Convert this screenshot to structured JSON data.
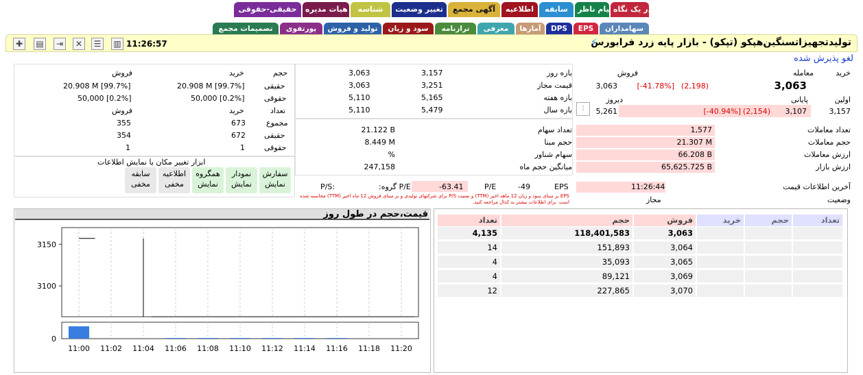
{
  "tabs_row1": [
    {
      "label": "در یک نگاه",
      "bg": "#c1273c",
      "fg": "#fff"
    },
    {
      "label": "پیام ناظر",
      "bg": "#14834a",
      "fg": "#fff"
    },
    {
      "label": "سابقه",
      "bg": "#2b8fd1",
      "fg": "#fff"
    },
    {
      "label": "اطلاعیه",
      "bg": "#a0131f",
      "fg": "#fff"
    },
    {
      "label": "آگهی مجمع",
      "bg": "#d9b23a",
      "fg": "#111"
    },
    {
      "label": "تغییر وضعیت",
      "bg": "#1d2f8c",
      "fg": "#fff"
    },
    {
      "label": "شناسه",
      "bg": "#c0c442",
      "fg": "#fff"
    },
    {
      "label": "هیات مدیره",
      "bg": "#7a1c4b",
      "fg": "#fff"
    },
    {
      "label": "حقیقی-حقوقی",
      "bg": "#7a2d9a",
      "fg": "#fff"
    }
  ],
  "tabs_row2": [
    {
      "label": "سهامداران",
      "bg": "#5a86b8",
      "fg": "#fff"
    },
    {
      "label": "EPS",
      "bg": "#d1263e",
      "fg": "#fff"
    },
    {
      "label": "DPS",
      "bg": "#1c2f9c",
      "fg": "#fff"
    },
    {
      "label": "آمارها",
      "bg": "#c79b74",
      "fg": "#fff"
    },
    {
      "label": "معرفی",
      "bg": "#40a6ad",
      "fg": "#fff"
    },
    {
      "label": "ترازنامه",
      "bg": "#4a8c3c",
      "fg": "#fff"
    },
    {
      "label": "سود و زیان",
      "bg": "#9a1a1a",
      "fg": "#fff"
    },
    {
      "label": "تولید و فروش",
      "bg": "#2d62a8",
      "fg": "#fff"
    },
    {
      "label": "پورتفوی",
      "bg": "#8a2f8a",
      "fg": "#fff"
    },
    {
      "label": "تصمیمات مجمع",
      "bg": "#2a7a52",
      "fg": "#fff"
    }
  ],
  "header": {
    "title": "تولیدتجهیزاتسنگین‌هپکو (تپکو) - بازار پایه زرد فرابورس",
    "time": "11:26:57",
    "status": "لغو پذیرش شده"
  },
  "price_box": {
    "buy_label": "خرید",
    "trade_label": "معامله",
    "sell_label": "فروش",
    "trade_value": "3,063",
    "sell_value": "3,063",
    "trade_change": "[-41.78%]",
    "trade_change_abs": "(2,198)",
    "first_label": "اولین",
    "close_label": "پایانی",
    "yesterday_label": "دیروز",
    "first_value": "3,157",
    "close_value": "3,107",
    "close_change_abs": "(2,154)",
    "close_change": "[-40.94%]",
    "yesterday_value": "5,261"
  },
  "ranges": [
    {
      "label": "بازه روز",
      "a": "3,157",
      "b": "3,063"
    },
    {
      "label": "قیمت مجاز",
      "a": "3,251",
      "b": "3,063"
    },
    {
      "label": "بازه هفته",
      "a": "5,165",
      "b": "5,110"
    },
    {
      "label": "بازه سال",
      "a": "5,479",
      "b": "5,110"
    }
  ],
  "hq": {
    "h_vol": "حجم",
    "h_buy": "خرید",
    "h_sell": "فروش",
    "l_real": "حقیقی",
    "l_legal": "حقوقی",
    "l_count": "تعداد",
    "l_total": "مجموع",
    "real_buy": "20.908 M [99.7%]",
    "real_sell": "20.908 M [99.7%]",
    "legal_buy": "50,000 [0.2%]",
    "legal_sell": "50,000 [0.2%]",
    "total_buy": "673",
    "total_sell": "355",
    "real_cbuy": "672",
    "real_csell": "354",
    "legal_cbuy": "1",
    "legal_csell": "1"
  },
  "stats": [
    {
      "label": "تعداد معاملات",
      "value": "1,577"
    },
    {
      "label": "حجم معاملات",
      "value": "21.307 M"
    },
    {
      "label": "ارزش معاملات",
      "value": "66.208 B"
    },
    {
      "label": "ارزش بازار",
      "value": "65,625.725 B"
    }
  ],
  "shares": [
    {
      "label": "تعداد سهام",
      "value": "21.122 B"
    },
    {
      "label": "حجم مبنا",
      "value": "8.449 M"
    },
    {
      "label": "سهام شناور",
      "value": "%"
    },
    {
      "label": "میانگین حجم ماه",
      "value": "247,158"
    }
  ],
  "info": {
    "last_label": "آخرین اطلاعات قیمت",
    "last_value": "11:26:44",
    "state_label": "وضعیت",
    "state_value": "مجاز"
  },
  "eps": {
    "eps_label": "EPS",
    "eps_value": "-49",
    "pe_label": "P/E",
    "pe_value": "",
    "gpe_label": "P/E گروه:",
    "gpe_value": "-63.41",
    "ps_label": "P/S:",
    "note": "EPS بر مبنای سود و زیان 12 ماهه اخیر (TTM) و نسبت P/S برای شرکتهای تولیدی و بر مبنای فروش 12 ماه اخیر (TTM) محاسبه شده است. برای اطلاعات بیشتر به کدال مراجعه کنید."
  },
  "tools": {
    "title": "ابزار تغییر مکان یا نمایش اطلاعات",
    "buttons": [
      {
        "name": "سفارش",
        "state": "نمایش",
        "on": true
      },
      {
        "name": "نمودار",
        "state": "نمایش",
        "on": true
      },
      {
        "name": "همگروه",
        "state": "نمایش",
        "on": true
      },
      {
        "name": "اطلاعیه",
        "state": "مخفی",
        "on": false
      },
      {
        "name": "سابقه",
        "state": "مخفی",
        "on": false
      }
    ]
  },
  "orderbook": {
    "headers": [
      "تعداد",
      "حجم",
      "خرید",
      "فروش",
      "حجم",
      "تعداد"
    ],
    "rows": [
      {
        "sell": "3,063",
        "vol": "118,401,583",
        "count": "4,135"
      },
      {
        "sell": "3,064",
        "vol": "151,893",
        "count": "14"
      },
      {
        "sell": "3,065",
        "vol": "35,093",
        "count": "4"
      },
      {
        "sell": "3,069",
        "vol": "89,121",
        "count": "4"
      },
      {
        "sell": "3,070",
        "vol": "227,865",
        "count": "12"
      }
    ]
  },
  "chart_data": {
    "type": "line",
    "title": "قیمت،حجم در طول روز",
    "x_ticks": [
      "11:00",
      "11:02",
      "11:04",
      "11:06",
      "11:08",
      "11:10",
      "11:12",
      "11:14",
      "11:16",
      "11:18",
      "11:20"
    ],
    "y_ticks": [
      3150,
      3100
    ],
    "ylim": [
      3063,
      3170
    ],
    "vol_tick": "0",
    "price_line": [
      {
        "t": 0,
        "v": 3157
      },
      {
        "t": 1,
        "v": 3157
      }
    ],
    "price_line2": [
      {
        "t": 4.5,
        "v": 3063
      },
      {
        "t": 20.8,
        "v": 3063
      }
    ],
    "spike": {
      "t": 4,
      "low": 3063,
      "high": 3157
    },
    "volumes": [
      {
        "t": 0,
        "v": 18
      },
      {
        "t": 6,
        "v": 1
      },
      {
        "t": 8,
        "v": 1
      },
      {
        "t": 10,
        "v": 1
      },
      {
        "t": 12,
        "v": 1
      },
      {
        "t": 14,
        "v": 1
      },
      {
        "t": 16,
        "v": 1
      }
    ],
    "color": "#3a7de0"
  }
}
